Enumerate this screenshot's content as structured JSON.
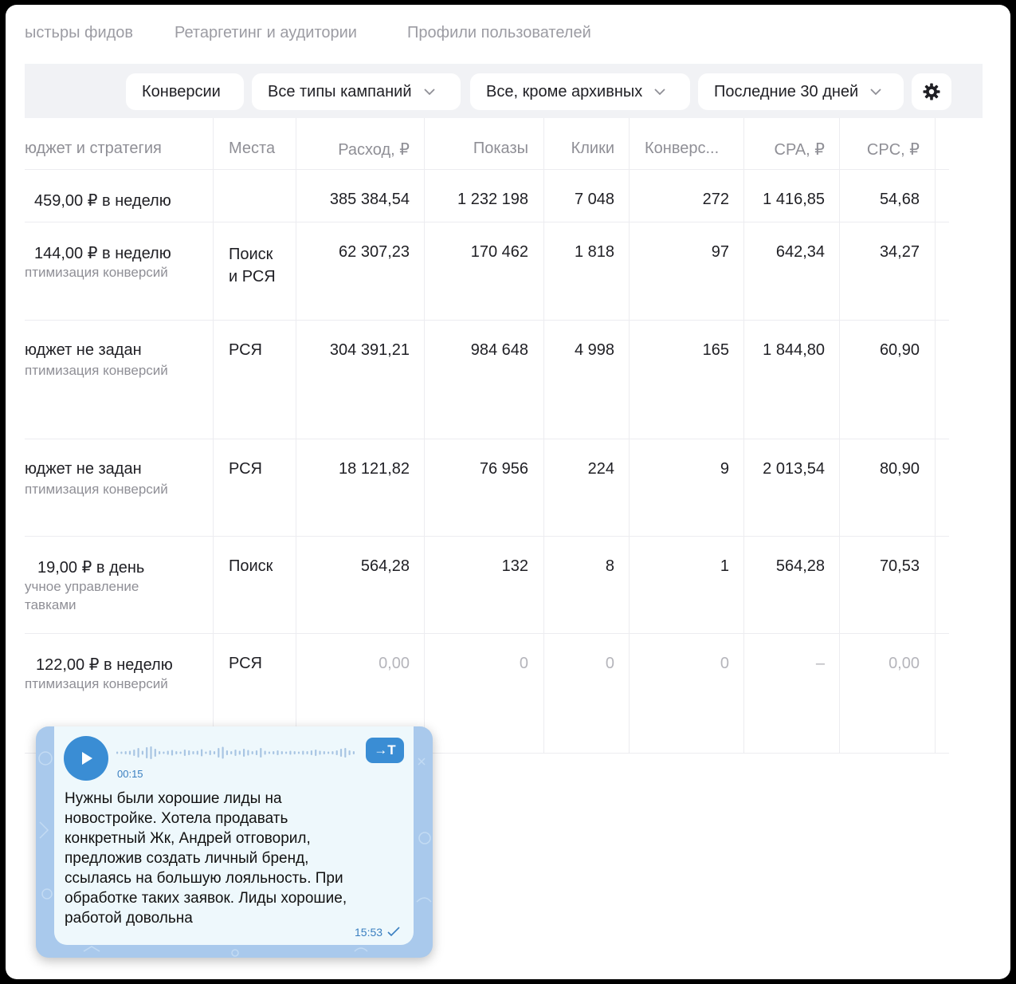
{
  "tabs": [
    {
      "label": "ыстьры фидов"
    },
    {
      "label": "Ретаргетинг и аудитории"
    },
    {
      "label": "Профили пользователей"
    }
  ],
  "filters": {
    "metric": "Конверсии",
    "campaign_types": "Все типы кампаний",
    "archive": "Все, кроме архивных",
    "period": "Последние 30 дней"
  },
  "icons": {
    "settings": "gear-icon",
    "dropdown": "chevron-down-icon",
    "play": "play-icon",
    "transcribe": "transcribe-icon",
    "read": "check-icon"
  },
  "columns": [
    "юджет и стратегия",
    "Места",
    "Расход, ₽",
    "Показы",
    "Клики",
    "Конверс...",
    "CPA, ₽",
    "CPC, ₽"
  ],
  "rows": [
    {
      "budget": "459,00 ₽ в неделю",
      "strategy": "",
      "places": "",
      "spend": "385 384,54",
      "impressions": "1 232 198",
      "clicks": "7 048",
      "conversions": "272",
      "cpa": "1 416,85",
      "cpc": "54,68"
    },
    {
      "budget": "144,00 ₽ в неделю",
      "strategy": "птимизация конверсий",
      "places": "Поиск\nи РСЯ",
      "spend": "62 307,23",
      "impressions": "170 462",
      "clicks": "1 818",
      "conversions": "97",
      "cpa": "642,34",
      "cpc": "34,27"
    },
    {
      "budget": "юджет не задан",
      "strategy": "птимизация конверсий",
      "places": "РСЯ",
      "spend": "304 391,21",
      "impressions": "984 648",
      "clicks": "4 998",
      "conversions": "165",
      "cpa": "1 844,80",
      "cpc": "60,90"
    },
    {
      "budget": "юджет не задан",
      "strategy": "птимизация конверсий",
      "places": "РСЯ",
      "spend": "18 121,82",
      "impressions": "76 956",
      "clicks": "224",
      "conversions": "9",
      "cpa": "2 013,54",
      "cpc": "80,90"
    },
    {
      "budget": "19,00 ₽ в день",
      "strategy": "учное управление\nтавками",
      "places": "Поиск",
      "spend": "564,28",
      "impressions": "132",
      "clicks": "8",
      "conversions": "1",
      "cpa": "564,28",
      "cpc": "70,53"
    },
    {
      "budget": "122,00 ₽ в неделю",
      "strategy": "птимизация конверсий",
      "places": "РСЯ",
      "spend": "0,00",
      "impressions": "0",
      "clicks": "0",
      "conversions": "0",
      "cpa": "–",
      "cpc": "0,00"
    }
  ],
  "voice_message": {
    "duration": "00:15",
    "transcribe_label": "→T",
    "text": "Нужны были хорошие лиды на\nновостройке. Хотела продавать\nконкретный Жк, Андрей отговорил,\nпредложив создать личный бренд,\nссылаясь на большую лояльность. При\nобработке таких заявок. Лиды хорошие,\nработой довольна",
    "time": "15:53"
  },
  "colors": {
    "accent": "#3a8dd4",
    "filter_bar": "#f1f2f5",
    "chat_background": "#a9c9ec",
    "bubble": "#eef8fc"
  }
}
